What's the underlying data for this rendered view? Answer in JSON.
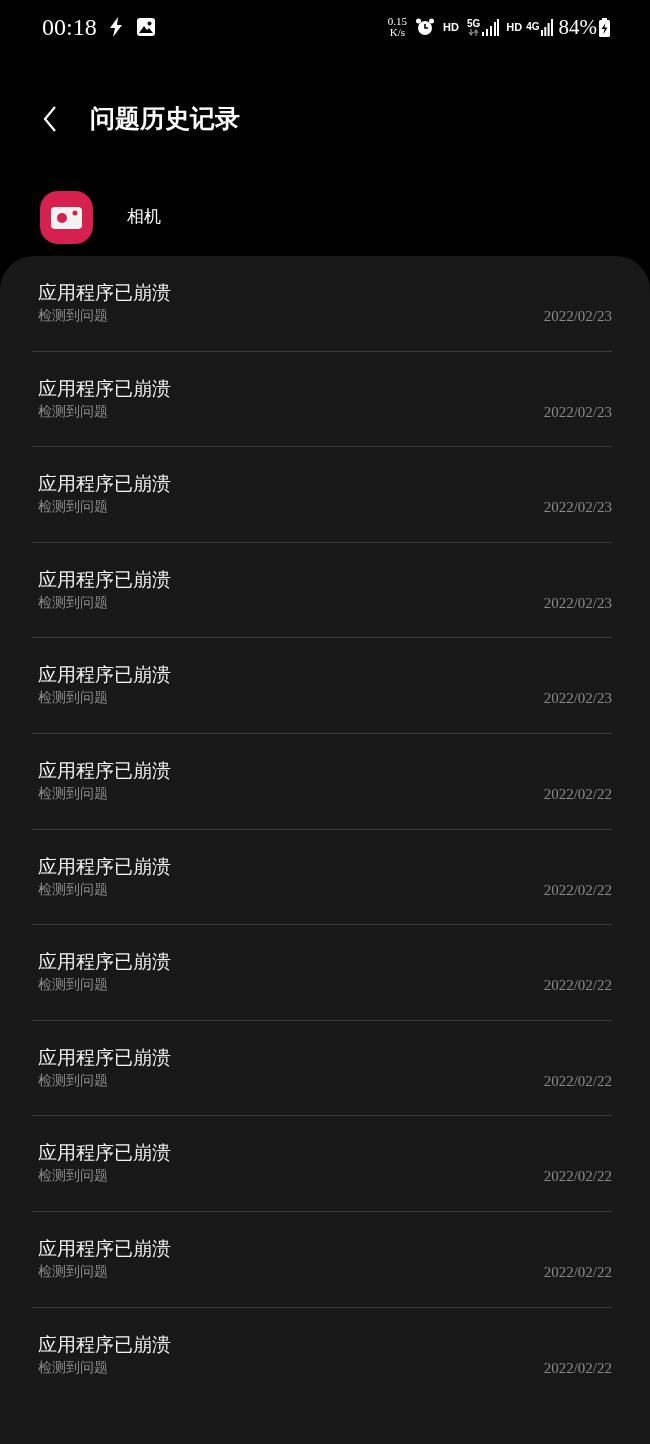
{
  "status_bar": {
    "time": "00:18",
    "net_speed": "0.15",
    "net_speed_unit": "K/s",
    "sim1_hd": "HD",
    "sim1_network": "5G",
    "sim2_hd": "HD",
    "sim2_network": "4G",
    "battery": "84%"
  },
  "header": {
    "title": "问题历史记录"
  },
  "app": {
    "name": "相机"
  },
  "items": [
    {
      "title": "应用程序已崩溃",
      "subtitle": "检测到问题",
      "date": "2022/02/23"
    },
    {
      "title": "应用程序已崩溃",
      "subtitle": "检测到问题",
      "date": "2022/02/23"
    },
    {
      "title": "应用程序已崩溃",
      "subtitle": "检测到问题",
      "date": "2022/02/23"
    },
    {
      "title": "应用程序已崩溃",
      "subtitle": "检测到问题",
      "date": "2022/02/23"
    },
    {
      "title": "应用程序已崩溃",
      "subtitle": "检测到问题",
      "date": "2022/02/23"
    },
    {
      "title": "应用程序已崩溃",
      "subtitle": "检测到问题",
      "date": "2022/02/22"
    },
    {
      "title": "应用程序已崩溃",
      "subtitle": "检测到问题",
      "date": "2022/02/22"
    },
    {
      "title": "应用程序已崩溃",
      "subtitle": "检测到问题",
      "date": "2022/02/22"
    },
    {
      "title": "应用程序已崩溃",
      "subtitle": "检测到问题",
      "date": "2022/02/22"
    },
    {
      "title": "应用程序已崩溃",
      "subtitle": "检测到问题",
      "date": "2022/02/22"
    },
    {
      "title": "应用程序已崩溃",
      "subtitle": "检测到问题",
      "date": "2022/02/22"
    },
    {
      "title": "应用程序已崩溃",
      "subtitle": "检测到问题",
      "date": "2022/02/22"
    }
  ]
}
